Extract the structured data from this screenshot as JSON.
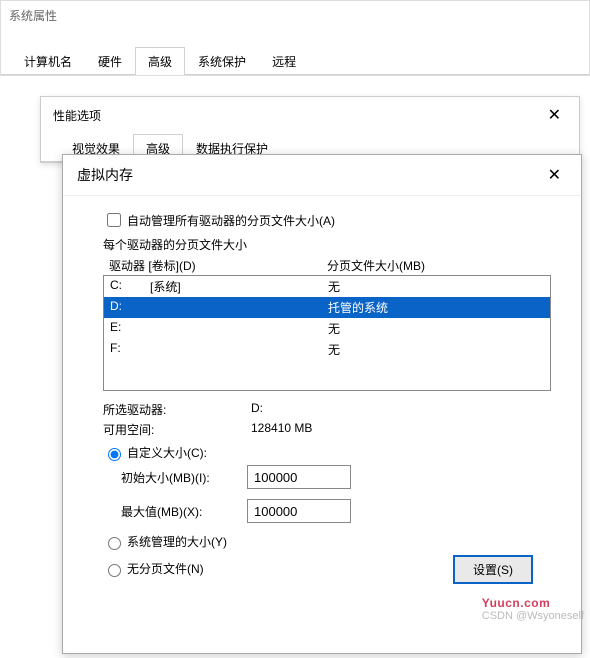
{
  "sysprops": {
    "title": "系统属性",
    "tabs": [
      "计算机名",
      "硬件",
      "高级",
      "系统保护",
      "远程"
    ],
    "active_tab": 2
  },
  "perf": {
    "title": "性能选项",
    "close": "✕",
    "tabs": [
      "视觉效果",
      "高级",
      "数据执行保护"
    ],
    "active_tab": 1
  },
  "vm": {
    "title": "虚拟内存",
    "close": "✕",
    "auto_manage_label": "自动管理所有驱动器的分页文件大小(A)",
    "auto_manage_checked": false,
    "each_drive_label": "每个驱动器的分页文件大小",
    "headers": {
      "drive": "驱动器 [卷标](D)",
      "size": "分页文件大小(MB)"
    },
    "drives": [
      {
        "letter": "C:",
        "label": "[系统]",
        "size": "无"
      },
      {
        "letter": "D:",
        "label": "",
        "size": "托管的系统"
      },
      {
        "letter": "E:",
        "label": "",
        "size": "无"
      },
      {
        "letter": "F:",
        "label": "",
        "size": "无"
      }
    ],
    "selected_index": 1,
    "selected_drive_label": "所选驱动器:",
    "selected_drive_value": "D:",
    "avail_label": "可用空间:",
    "avail_value": "128410 MB",
    "custom_label": "自定义大小(C):",
    "initial_label": "初始大小(MB)(I):",
    "initial_value": "100000",
    "max_label": "最大值(MB)(X):",
    "max_value": "100000",
    "sys_managed_label": "系统管理的大小(Y)",
    "no_paging_label": "无分页文件(N)",
    "radio_selected": "custom",
    "set_button": "设置(S)"
  },
  "watermark": {
    "line1": "Yuucn.com",
    "line2": "CSDN @Wsyoneself"
  }
}
